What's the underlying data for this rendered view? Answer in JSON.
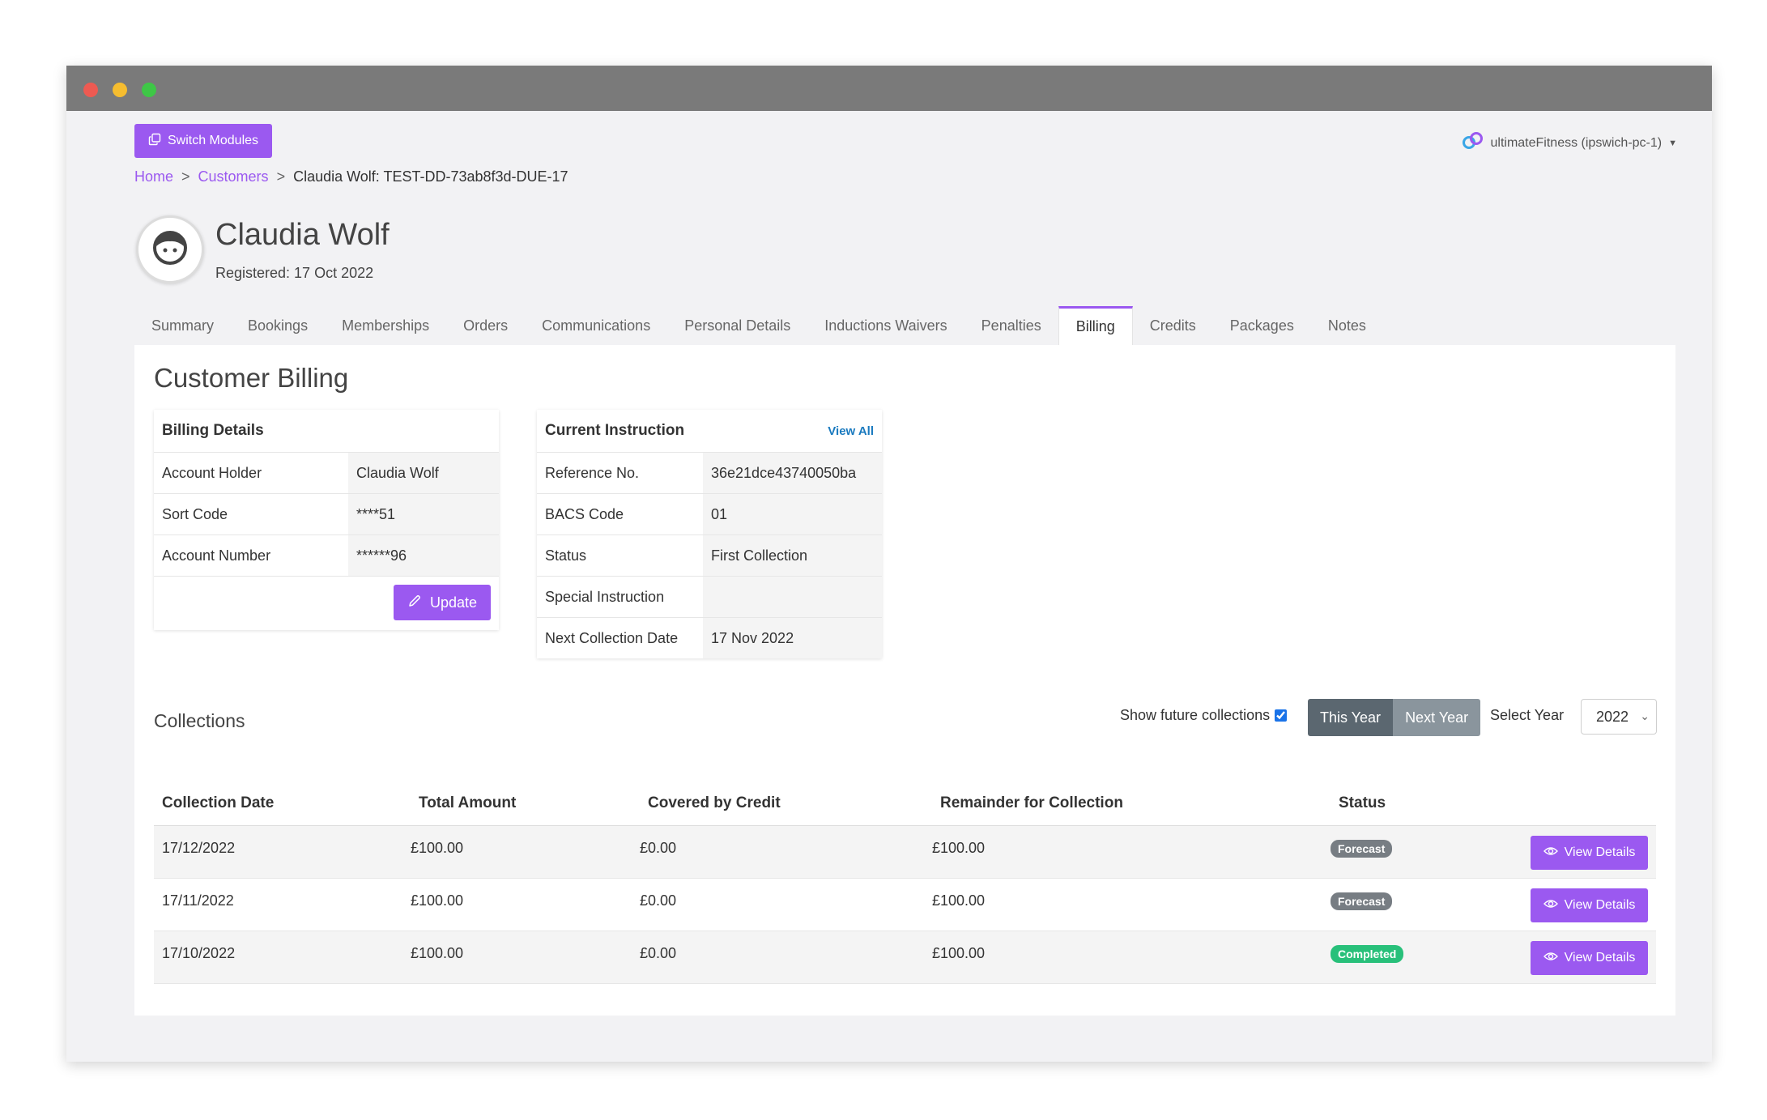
{
  "header": {
    "switch_modules_label": "Switch Modules",
    "account_label": "ultimateFitness (ipswich-pc-1)"
  },
  "breadcrumb": {
    "home": "Home",
    "separator": ">",
    "customers": "Customers",
    "current": "Claudia Wolf: TEST-DD-73ab8f3d-DUE-17"
  },
  "customer": {
    "name": "Claudia Wolf",
    "registered": "Registered: 17 Oct 2022"
  },
  "tabs": [
    {
      "label": "Summary"
    },
    {
      "label": "Bookings"
    },
    {
      "label": "Memberships"
    },
    {
      "label": "Orders"
    },
    {
      "label": "Communications"
    },
    {
      "label": "Personal Details"
    },
    {
      "label": "Inductions Waivers"
    },
    {
      "label": "Penalties"
    },
    {
      "label": "Billing"
    },
    {
      "label": "Credits"
    },
    {
      "label": "Packages"
    },
    {
      "label": "Notes"
    }
  ],
  "active_tab": "Billing",
  "billing": {
    "page_title": "Customer Billing",
    "details": {
      "title": "Billing Details",
      "rows": [
        {
          "label": "Account Holder",
          "value": "Claudia Wolf"
        },
        {
          "label": "Sort Code",
          "value": "****51"
        },
        {
          "label": "Account Number",
          "value": "******96"
        }
      ],
      "update_label": "Update"
    },
    "instruction": {
      "title": "Current Instruction",
      "view_all_label": "View All",
      "rows": [
        {
          "label": "Reference No.",
          "value": "36e21dce43740050ba"
        },
        {
          "label": "BACS Code",
          "value": "01"
        },
        {
          "label": "Status",
          "value": "First Collection"
        },
        {
          "label": "Special Instruction",
          "value": ""
        },
        {
          "label": "Next Collection Date",
          "value": "17 Nov 2022"
        }
      ]
    }
  },
  "collections": {
    "title": "Collections",
    "show_future_label": "Show future collections",
    "show_future_checked": true,
    "this_year_label": "This Year",
    "next_year_label": "Next Year",
    "select_year_label": "Select Year",
    "selected_year": "2022",
    "columns": [
      "Collection Date",
      "Total Amount",
      "Covered by Credit",
      "Remainder for Collection",
      "Status"
    ],
    "view_details_label": "View Details",
    "rows": [
      {
        "date": "17/12/2022",
        "total": "£100.00",
        "credit": "£0.00",
        "remainder": "£100.00",
        "status": "Forecast"
      },
      {
        "date": "17/11/2022",
        "total": "£100.00",
        "credit": "£0.00",
        "remainder": "£100.00",
        "status": "Forecast"
      },
      {
        "date": "17/10/2022",
        "total": "£100.00",
        "credit": "£0.00",
        "remainder": "£100.00",
        "status": "Completed"
      }
    ]
  },
  "colors": {
    "accent": "#9b59f0",
    "link_blue": "#1a7abf",
    "forecast_badge": "#777d83",
    "completed_badge": "#28c07a"
  }
}
